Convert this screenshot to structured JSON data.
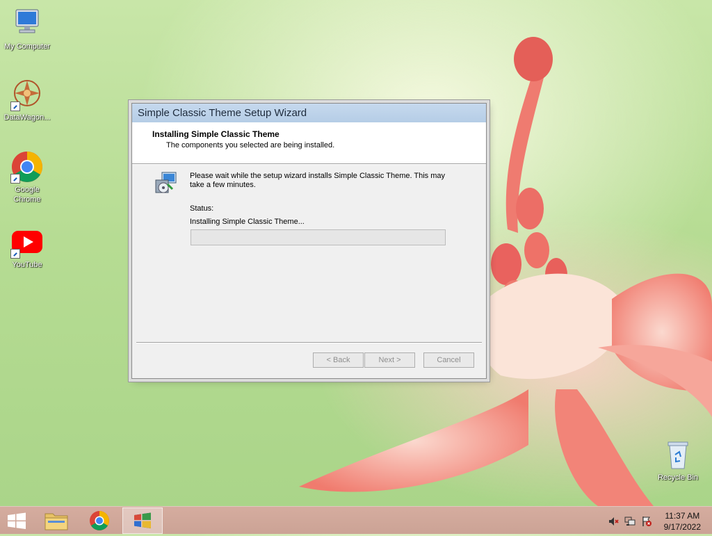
{
  "desktop": {
    "icons": [
      {
        "label": "My Computer",
        "icon": "computer-icon"
      },
      {
        "label": "DataWagon...",
        "icon": "datawagon-icon"
      },
      {
        "label": "Google Chrome",
        "icon": "chrome-icon"
      },
      {
        "label": "YouTube",
        "icon": "youtube-icon"
      },
      {
        "label": "Recycle Bin",
        "icon": "recycle-bin-icon"
      }
    ]
  },
  "wizard": {
    "title": "Simple Classic Theme Setup Wizard",
    "header_title": "Installing Simple Classic Theme",
    "header_subtitle": "The components you selected are being installed.",
    "body_text": "Please wait while the setup wizard installs Simple Classic Theme. This may take a few minutes.",
    "status_label": "Status:",
    "status_value": "Installing Simple Classic Theme...",
    "progress": 0.0,
    "buttons": {
      "back": "< Back",
      "next": "Next >",
      "cancel": "Cancel"
    }
  },
  "taskbar": {
    "items": [
      {
        "name": "start-button",
        "icon": "windows-logo-icon"
      },
      {
        "name": "file-explorer",
        "icon": "folder-icon"
      },
      {
        "name": "google-chrome",
        "icon": "chrome-icon"
      },
      {
        "name": "setup-wizard",
        "icon": "setup-icon",
        "active": true
      }
    ],
    "tray_icons": [
      "volume-muted-icon",
      "network-icon",
      "action-center-icon"
    ],
    "time": "11:37 AM",
    "date": "9/17/2022"
  },
  "colors": {
    "titlebar": "#b5cde6",
    "window_bg": "#f0f0f0",
    "taskbar": "#cfa296"
  }
}
